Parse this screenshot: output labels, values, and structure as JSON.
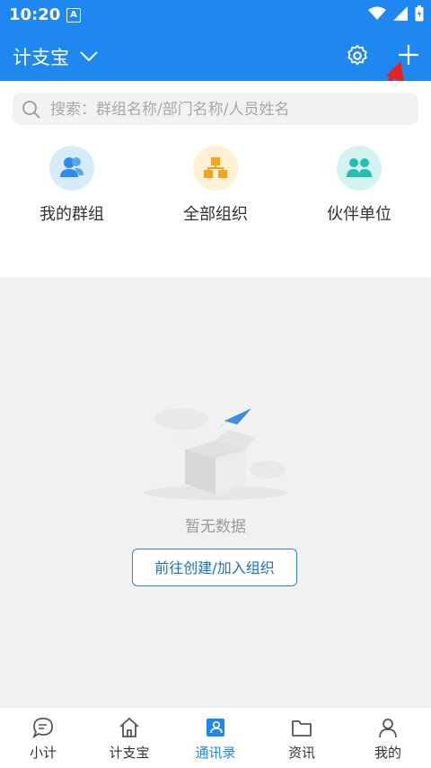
{
  "status": {
    "time": "10:20",
    "app_badge": "A"
  },
  "header": {
    "title": "计支宝"
  },
  "search": {
    "placeholder": "搜索：群组名称/部门名称/人员姓名"
  },
  "quick_links": [
    {
      "label": "我的群组"
    },
    {
      "label": "全部组织"
    },
    {
      "label": "伙伴单位"
    }
  ],
  "empty": {
    "text": "暂无数据",
    "button_label": "前往创建/加入组织"
  },
  "tabs": [
    {
      "label": "小计"
    },
    {
      "label": "计支宝"
    },
    {
      "label": "通讯录",
      "active": true
    },
    {
      "label": "资讯"
    },
    {
      "label": "我的"
    }
  ],
  "colors": {
    "primary": "#1e87f0",
    "annotation_arrow": "#e8231f"
  }
}
